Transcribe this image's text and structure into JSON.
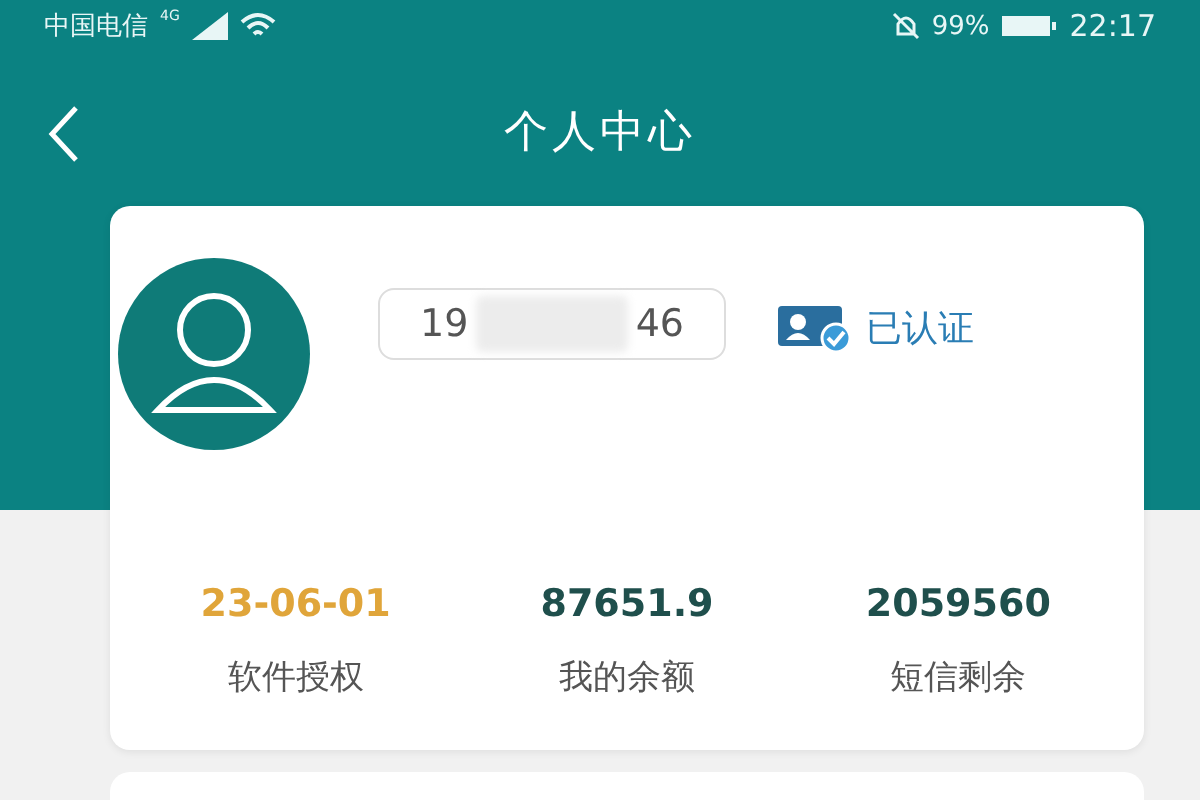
{
  "status_bar": {
    "carrier": "中国电信",
    "network": "4G",
    "battery": "99%",
    "time": "22:17"
  },
  "nav": {
    "title": "个人中心"
  },
  "profile": {
    "phone_start": "19",
    "phone_end": "46",
    "verified": true,
    "verified_label": "已认证"
  },
  "stats": [
    {
      "value": "23-06-01",
      "label": "软件授权",
      "color": "#e0a53a"
    },
    {
      "value": "87651.9",
      "label": "我的余额",
      "color": "#1f4f4c"
    },
    {
      "value": "2059560",
      "label": "短信剩余",
      "color": "#1f4f4c"
    }
  ]
}
